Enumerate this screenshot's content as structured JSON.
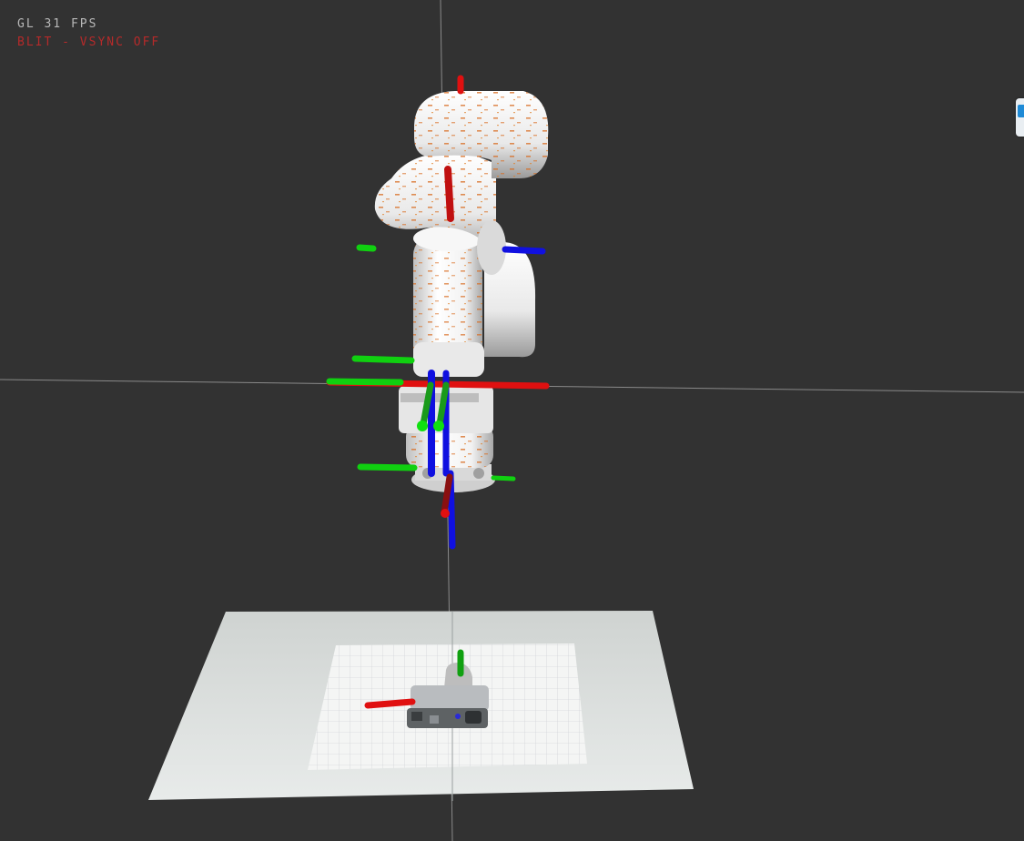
{
  "hud": {
    "fps_label": "GL 31 FPS",
    "mode_label": "BLIT - VSYNC OFF"
  },
  "colors": {
    "background": "#323232",
    "fps_text": "#b8b8b8",
    "mode_text": "#b52a2a",
    "axis_x": "#e01010",
    "axis_y": "#10d010",
    "axis_z": "#1010e0",
    "robot_body": "#f0f0f0",
    "robot_paint": "#d86a1e",
    "table_surface": "#dfe3e1",
    "handle_accent": "#1e8ad6"
  },
  "side_panel": {
    "icon": "panel-toggle-icon"
  }
}
